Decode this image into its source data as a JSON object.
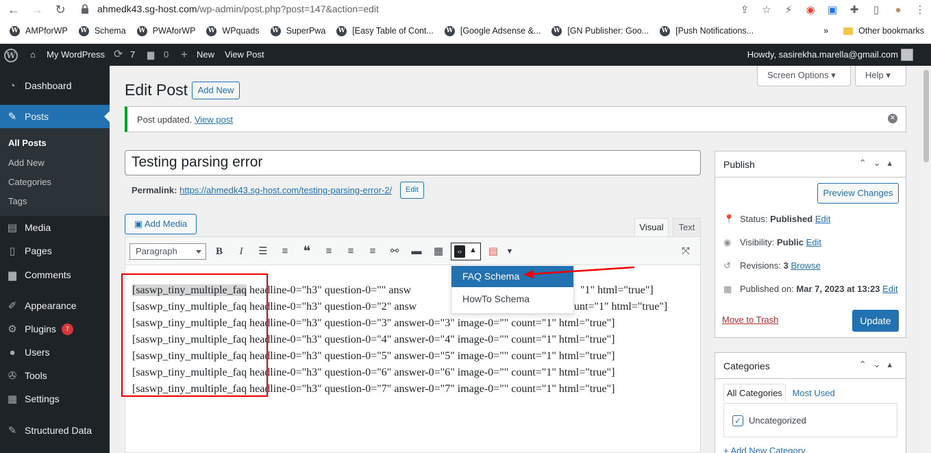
{
  "browser": {
    "url_host": "ahmedk43.sg-host.com",
    "url_path": "/wp-admin/post.php?post=147&action=edit",
    "bookmarks": [
      "AMPforWP",
      "Schema",
      "PWAforWP",
      "WPquads",
      "SuperPwa",
      "[Easy Table of Cont...",
      "[Google Adsense &...",
      "[GN Publisher: Goo...",
      "[Push Notifications..."
    ],
    "bookmarks_overflow": "»",
    "other_bookmarks": "Other bookmarks"
  },
  "adminbar": {
    "site_name": "My WordPress",
    "updates_count": "7",
    "comments_count": "0",
    "new_label": "New",
    "view_post": "View Post",
    "howdy": "Howdy, sasirekha.marella@gmail.com"
  },
  "sidebar": {
    "items": [
      {
        "label": "Dashboard",
        "icon": "dashboard-icon"
      },
      {
        "label": "Posts",
        "icon": "pin-icon"
      },
      {
        "label": "Media",
        "icon": "media-icon"
      },
      {
        "label": "Pages",
        "icon": "pages-icon"
      },
      {
        "label": "Comments",
        "icon": "comment-icon"
      },
      {
        "label": "Appearance",
        "icon": "brush-icon"
      },
      {
        "label": "Plugins",
        "icon": "plugin-icon",
        "badge": "7"
      },
      {
        "label": "Users",
        "icon": "user-icon"
      },
      {
        "label": "Tools",
        "icon": "wrench-icon"
      },
      {
        "label": "Settings",
        "icon": "settings-icon"
      },
      {
        "label": "Structured Data",
        "icon": "pin-icon"
      }
    ],
    "sub_items": [
      "All Posts",
      "Add New",
      "Categories",
      "Tags"
    ]
  },
  "main": {
    "page_title": "Edit Post",
    "add_new": "Add New",
    "screen_options": "Screen Options",
    "help": "Help",
    "notice_text": "Post updated.",
    "notice_link": "View post",
    "post_title": "Testing parsing error",
    "permalink_label": "Permalink:",
    "permalink_url": "https://ahmedk43.sg-host.com/testing-parsing-error-2/",
    "permalink_edit": "Edit",
    "add_media": "Add Media",
    "tab_visual": "Visual",
    "tab_text": "Text",
    "format_select": "Paragraph",
    "shortcode_tag": "[saswp_tiny_multiple_faq",
    "lines": [
      " headline-0=\"h3\" question-0=\"\" answ",
      " headline-0=\"h3\" question-0=\"2\" answ",
      " headline-0=\"h3\" question-0=\"3\" answer-0=\"3\" image-0=\"\" count=\"1\" html=\"true\"]",
      " headline-0=\"h3\" question-0=\"4\" answer-0=\"4\" image-0=\"\" count=\"1\" html=\"true\"]",
      " headline-0=\"h3\" question-0=\"5\" answer-0=\"5\" image-0=\"\" count=\"1\" html=\"true\"]",
      " headline-0=\"h3\" question-0=\"6\" answer-0=\"6\" image-0=\"\" count=\"1\" html=\"true\"]",
      " headline-0=\"h3\" question-0=\"7\" answer-0=\"7\" image-0=\"\" count=\"1\" html=\"true\"]"
    ],
    "line1_tail": "\"1\" html=\"true\"]",
    "line2_tail": "unt=\"1\" html=\"true\"]",
    "dropdown": [
      "FAQ Schema",
      "HowTo Schema"
    ]
  },
  "publish": {
    "title": "Publish",
    "preview": "Preview Changes",
    "status_label": "Status:",
    "status_value": "Published",
    "visibility_label": "Visibility:",
    "visibility_value": "Public",
    "revisions_label": "Revisions:",
    "revisions_value": "3",
    "browse": "Browse",
    "published_label": "Published on:",
    "published_value": "Mar 7, 2023 at 13:23",
    "edit": "Edit",
    "trash": "Move to Trash",
    "update": "Update"
  },
  "categories": {
    "title": "Categories",
    "tab_all": "All Categories",
    "tab_most": "Most Used",
    "item": "Uncategorized",
    "add_new": "+ Add New Category"
  },
  "colors": {
    "accent": "#2271b1",
    "adminbar": "#1d2327",
    "success": "#00a32a",
    "highlight_box": "#ee0000"
  }
}
